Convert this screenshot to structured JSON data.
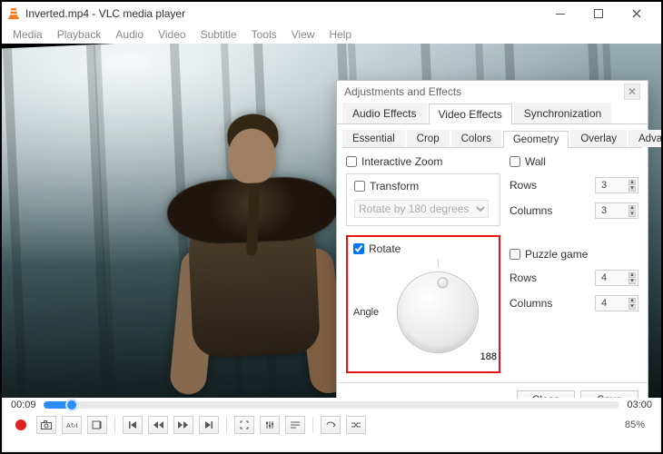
{
  "window": {
    "title": "Inverted.mp4 - VLC media player"
  },
  "menu": {
    "media": "Media",
    "playback": "Playback",
    "audio": "Audio",
    "video": "Video",
    "subtitle": "Subtitle",
    "tools": "Tools",
    "view": "View",
    "help": "Help"
  },
  "dialog": {
    "title": "Adjustments and Effects",
    "tabs": {
      "audio": "Audio Effects",
      "video": "Video Effects",
      "sync": "Synchronization"
    },
    "subtabs": {
      "essential": "Essential",
      "crop": "Crop",
      "colors": "Colors",
      "geometry": "Geometry",
      "overlay": "Overlay",
      "advanced": "Advanced"
    },
    "geometry": {
      "interactive_zoom": "Interactive Zoom",
      "transform": "Transform",
      "transform_option": "Rotate by 180 degrees",
      "rotate": "Rotate",
      "angle_label": "Angle",
      "angle_value": "188",
      "wall": "Wall",
      "rows_label": "Rows",
      "columns_label": "Columns",
      "wall_rows": "3",
      "wall_cols": "3",
      "puzzle": "Puzzle game",
      "puzzle_rows": "4",
      "puzzle_cols": "4"
    },
    "buttons": {
      "close": "Close",
      "save": "Save"
    }
  },
  "player": {
    "elapsed": "00:09",
    "total": "03:00",
    "progress_pct": 5,
    "volume_pct": "85%"
  }
}
